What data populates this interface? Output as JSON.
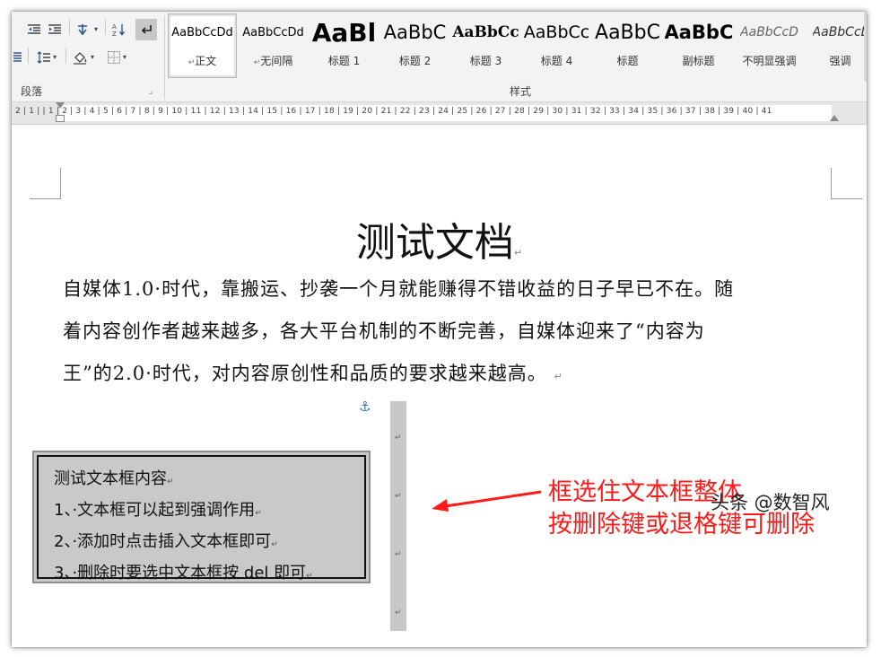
{
  "ribbon": {
    "paragraph_group_label": "段落",
    "styles_group_label": "样式",
    "styles": [
      {
        "preview": "AaBbCcDd",
        "name": "正文",
        "selected": true
      },
      {
        "preview": "AaBbCcDd",
        "name": "无间隔",
        "selected": false
      },
      {
        "preview": "AaBl",
        "name": "标题 1",
        "selected": false
      },
      {
        "preview": "AaBbC",
        "name": "标题 2",
        "selected": false
      },
      {
        "preview": "AaBbCc",
        "name": "标题 3",
        "selected": false
      },
      {
        "preview": "AaBbCc",
        "name": "标题 4",
        "selected": false
      },
      {
        "preview": "AaBbC",
        "name": "标题",
        "selected": false
      },
      {
        "preview": "AaBbC",
        "name": "副标题",
        "selected": false
      },
      {
        "preview": "AaBbCcD",
        "name": "不明显强调",
        "selected": false
      },
      {
        "preview": "AaBbCcL",
        "name": "强调",
        "selected": false
      }
    ]
  },
  "ruler": {
    "labels": "2 | 1 |   | 1 | 2 | 3 | 4 | 5 | 6 | 7 | 8 | 9 | 10 | 11 | 12 | 13 | 14 | 15 | 16 | 17 | 18 | 19 | 20 | 21 | 22 | 23 | 24 | 25 | 26 | 27 | 28 | 29 | 30 | 31 | 32 | 33 | 34 | 35 | 36 | 37 | 38 | 39 | 40 | 41"
  },
  "document": {
    "title": "测试文档",
    "paragraph_lines": [
      "自媒体1.0·时代，靠搬运、抄袭一个月就能赚得不错收益的日子早已不在。随",
      "着内容创作者越来越多，各大平台机制的不断完善，自媒体迎来了“内容为",
      "王”的2.0·时代，对内容原创性和品质的要求越来越高。"
    ],
    "textbox_lines": [
      "测试文本框内容",
      "1、·文本框可以起到强调作用",
      "2、·添加时点击插入文本框即可",
      "3、·删除时要选中文本框按 del 即可"
    ],
    "paragraph_mark": "↵"
  },
  "annotation": {
    "line1": "框选住文本框整体",
    "line2": "按删除键或退格键可删除",
    "color": "#ff1a1a"
  },
  "watermark": "头条 @数智风"
}
